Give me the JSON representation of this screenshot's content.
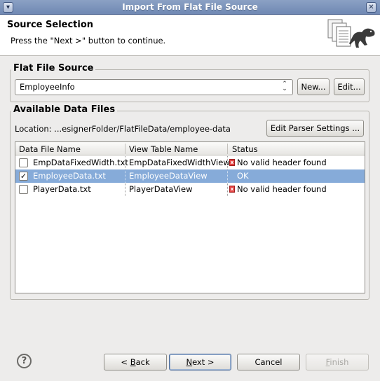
{
  "window": {
    "title": "Import From Flat File Source"
  },
  "header": {
    "title": "Source Selection",
    "message": "Press the \"Next >\" button to continue."
  },
  "flat_file_source": {
    "group_label": "Flat File Source",
    "selected": "EmployeeInfo",
    "new_label": "New...",
    "edit_label": "Edit..."
  },
  "available_data_files": {
    "group_label": "Available Data Files",
    "location": "Location: ...esignerFolder/FlatFileData/employee-data",
    "edit_parser_label": "Edit Parser Settings ...",
    "columns": [
      "Data File Name",
      "View Table Name",
      "Status"
    ],
    "rows": [
      {
        "checked": false,
        "file": "EmpDataFixedWidth.txt",
        "view": "EmpDataFixedWidthView",
        "status": "No valid header found",
        "error": true
      },
      {
        "checked": true,
        "file": "EmployeeData.txt",
        "view": "EmployeeDataView",
        "status": "OK",
        "error": false
      },
      {
        "checked": false,
        "file": "PlayerData.txt",
        "view": "PlayerDataView",
        "status": "No valid header found",
        "error": true
      }
    ]
  },
  "footer": {
    "help_icon": "help-icon",
    "back": {
      "mnemonic": "B",
      "rest": "ack",
      "prefix": "< "
    },
    "next": {
      "mnemonic": "N",
      "rest": "ext >"
    },
    "cancel": "Cancel",
    "finish": {
      "mnemonic": "F",
      "rest": "inish"
    }
  },
  "colors": {
    "selection": "#86abd9",
    "titlebar": "#7b93bb",
    "error": "#e24343"
  }
}
